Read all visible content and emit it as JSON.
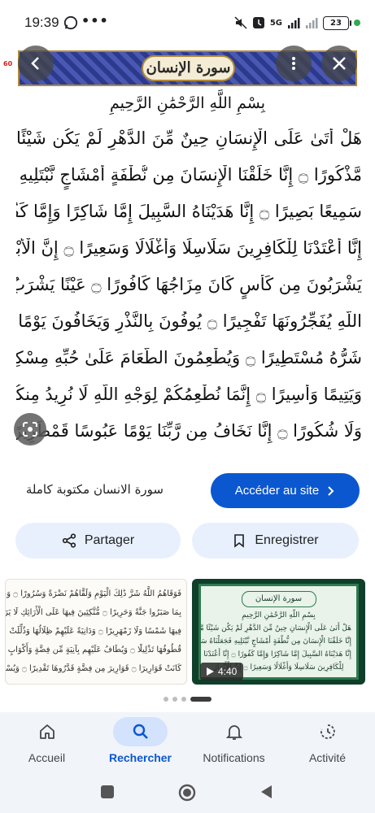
{
  "status_bar": {
    "time": "19:39",
    "network": "5G",
    "battery": "23",
    "icons": [
      "whatsapp-icon",
      "more-dots-icon",
      "mute-icon",
      "alarm-icon",
      "signal-icon",
      "battery-icon"
    ]
  },
  "viewer": {
    "side_number": "60",
    "surah_title": "سورة الإنسان",
    "basmala": "بِسْمِ اللَّهِ الرَّحْمَٰنِ الرَّحِيمِ",
    "verses": [
      "هَلْ أَتَىٰ عَلَى الْإِنسَانِ حِينٌ مِّنَ الدَّهْرِ لَمْ يَكُن شَيْئًا",
      "مَّذْكُورًا ۝ إِنَّا خَلَقْنَا الْإِنسَانَ مِن نُّطْفَةٍ أَمْشَاجٍ نَّبْتَلِيهِ فَجَعَلْنَاهُ",
      "سَمِيعًا بَصِيرًا ۝ إِنَّا هَدَيْنَاهُ السَّبِيلَ إِمَّا شَاكِرًا وَإِمَّا كَفُورًا ۝",
      "إِنَّا أَعْتَدْنَا لِلْكَافِرِينَ سَلَاسِلَا وَأَغْلَالًا وَسَعِيرًا ۝ إِنَّ الْأَبْرَارَ",
      "يَشْرَبُونَ مِن كَأْسٍ كَانَ مِزَاجُهَا كَافُورًا ۝ عَيْنًا يَشْرَبُ بِهَا عِبَادُ",
      "اللَّهِ يُفَجِّرُونَهَا تَفْجِيرًا ۝ يُوفُونَ بِالنَّذْرِ وَيَخَافُونَ يَوْمًا كَانَ",
      "شَرُّهُ مُسْتَطِيرًا ۝ وَيُطْعِمُونَ الطَّعَامَ عَلَىٰ حُبِّهِ مِسْكِينًا",
      "وَيَتِيمًا وَأَسِيرًا ۝ إِنَّمَا نُطْعِمُكُمْ لِوَجْهِ اللَّهِ لَا نُرِيدُ مِنكُمْ جَزَاءً",
      "وَلَا شُكُورًا ۝ إِنَّا نَخَافُ مِن رَّبِّنَا يَوْمًا عَبُوسًا قَمْطَرِيرًا ۝"
    ]
  },
  "source": {
    "title": "سورة الانسان مكتوبة كاملة",
    "visit_label": "Accéder au site"
  },
  "actions": {
    "share_label": "Partager",
    "save_label": "Enregistrer"
  },
  "related": {
    "left_lines": [
      "فَوَقَاهُمُ اللَّهُ شَرَّ ذَٰلِكَ الْيَوْمِ وَلَقَّاهُمْ نَضْرَةً وَسُرُورًا ۝ وَجَزَاهُم",
      "بِمَا صَبَرُوا جَنَّةً وَحَرِيرًا ۝ مُّتَّكِئِينَ فِيهَا عَلَى الْأَرَائِكِ لَا يَرَوْنَ",
      "فِيهَا شَمْسًا وَلَا زَمْهَرِيرًا ۝ وَدَانِيَةً عَلَيْهِمْ ظِلَالُهَا وَذُلِّلَتْ",
      "قُطُوفُهَا تَذْلِيلًا ۝ وَيُطَافُ عَلَيْهِم بِآنِيَةٍ مِّن فِضَّةٍ وَأَكْوَابٍ",
      "كَانَتْ قَوَارِيرَا ۝ قَوَارِيرَ مِن فِضَّةٍ قَدَّرُوهَا تَقْدِيرًا ۝ وَيُسْقَوْنَ",
      "فِيهَا كَأْسًا كَانَ مِزَاجُهَا زَنجَبِيلًا ۝ عَيْنًا فِيهَا تُسَمَّىٰ"
    ],
    "right_title": "سورة الإنسان",
    "right_lines": [
      "بِسْمِ اللَّهِ الرَّحْمَٰنِ الرَّحِيمِ",
      "هَلْ أَتَىٰ عَلَى الْإِنسَانِ حِينٌ مِّنَ الدَّهْرِ لَمْ يَكُن شَيْئًا مَّذْكُورًا",
      "إِنَّا خَلَقْنَا الْإِنسَانَ مِن نُّطْفَةٍ أَمْشَاجٍ نَّبْتَلِيهِ فَجَعَلْنَاهُ سَمِيعًا بَصِيرًا",
      "إِنَّا هَدَيْنَاهُ السَّبِيلَ إِمَّا شَاكِرًا وَإِمَّا كَفُورًا ۝ إِنَّا أَعْتَدْنَا",
      "لِلْكَافِرِينَ سَلَاسِلَا وَأَغْلَالًا وَسَعِيرًا ۝ إِنَّ الْأَبْرَارَ"
    ],
    "video_duration": "4:40"
  },
  "bottom_nav": {
    "items": [
      {
        "label": "Accueil",
        "icon": "home-icon"
      },
      {
        "label": "Rechercher",
        "icon": "search-icon"
      },
      {
        "label": "Notifications",
        "icon": "bell-icon"
      },
      {
        "label": "Activité",
        "icon": "activity-icon"
      }
    ],
    "active": "Rechercher"
  },
  "colors": {
    "accent": "#0b57d0",
    "pill": "#e8f0fe",
    "nav_active_pill": "#d3e3fd",
    "nav_bg": "#f1f4f9"
  }
}
